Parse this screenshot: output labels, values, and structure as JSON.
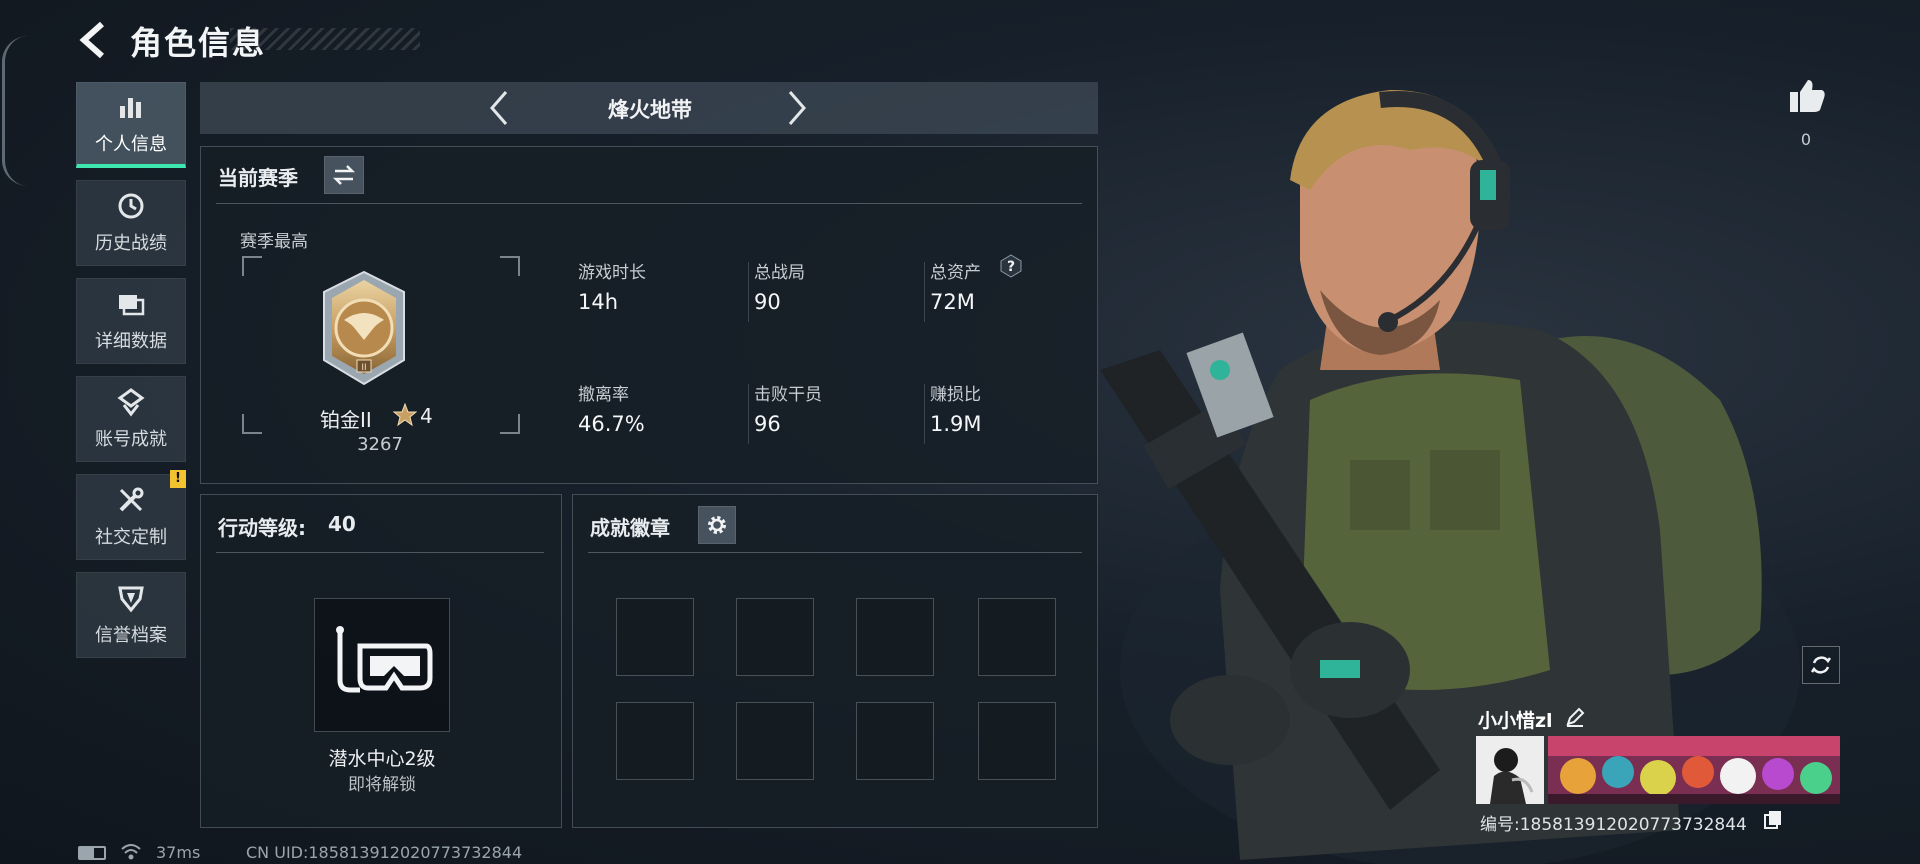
{
  "header": {
    "title": "角色信息"
  },
  "sidebar": {
    "items": [
      {
        "label": "个人信息",
        "icon": "bar-chart-icon",
        "active": true
      },
      {
        "label": "历史战绩",
        "icon": "clock-icon",
        "active": false
      },
      {
        "label": "详细数据",
        "icon": "cards-icon",
        "active": false
      },
      {
        "label": "账号成就",
        "icon": "achievement-icon",
        "active": false
      },
      {
        "label": "社交定制",
        "icon": "tools-icon",
        "active": false,
        "badge": "!"
      },
      {
        "label": "信誉档案",
        "icon": "shield-icon",
        "active": false
      }
    ]
  },
  "mode": {
    "title": "烽火地带"
  },
  "season": {
    "title": "当前赛季",
    "best_label": "赛季最高",
    "rank_name": "铂金II",
    "rank_stars": "4",
    "rank_score": "3267",
    "stats": [
      {
        "label": "游戏时长",
        "value": "14h"
      },
      {
        "label": "总战局",
        "value": "90"
      },
      {
        "label": "总资产",
        "value": "72M",
        "help": "?"
      },
      {
        "label": "撤离率",
        "value": "46.7%"
      },
      {
        "label": "击败干员",
        "value": "96"
      },
      {
        "label": "赚损比",
        "value": "1.9M"
      }
    ]
  },
  "action_level": {
    "title": "行动等级:",
    "value": "40",
    "unlock_name": "潜水中心2级",
    "unlock_status": "即将解锁"
  },
  "achievements": {
    "title": "成就徽章",
    "slots": 8
  },
  "character": {
    "likes": "0"
  },
  "player": {
    "name": "小小惜zl",
    "id_text": "编号:18581391202077373​2844"
  },
  "status_bar": {
    "ping": "37ms",
    "uid": "CN UID:18581391202077373​2844"
  },
  "colors": {
    "accent": "#3ee6b0",
    "warning": "#f2c230",
    "medal": "#c9a064"
  }
}
